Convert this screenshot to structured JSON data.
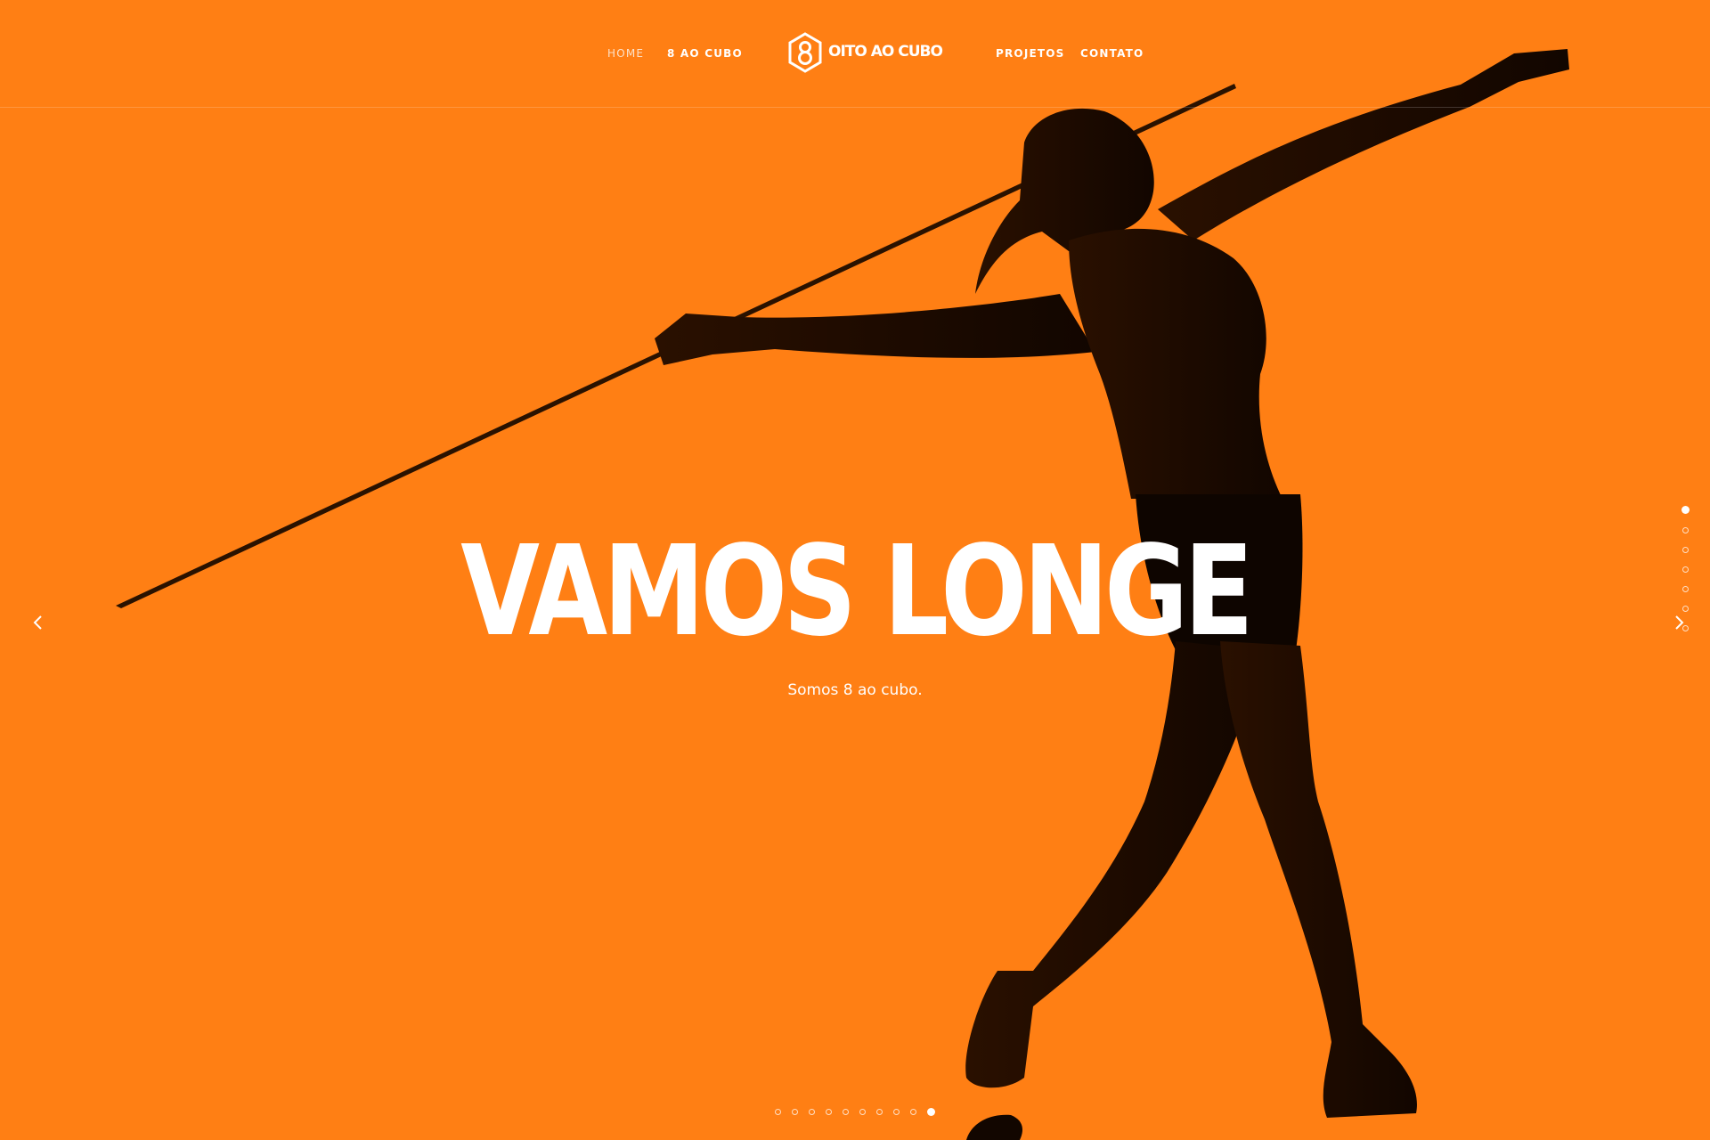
{
  "colors": {
    "background": "#ff7f14",
    "silhouette": "#1a0a00",
    "text": "#ffffff"
  },
  "nav": {
    "home": "HOME",
    "about": "8 AO CUBO",
    "projects": "PROJETOS",
    "contact": "CONTATO",
    "active": "home"
  },
  "logo": {
    "text": "OITO AO CUBO",
    "icon": "hexagon-8-icon"
  },
  "hero": {
    "headline": "VAMOS LONGE",
    "subline": "Somos 8 ao cubo.",
    "image": "javelin-thrower-silhouette"
  },
  "slider": {
    "vertical_dots_count": 7,
    "vertical_active_index": 0,
    "horizontal_dots_count": 10,
    "horizontal_active_index": 9,
    "prev_icon": "chevron-left-icon",
    "next_icon": "chevron-right-icon"
  }
}
